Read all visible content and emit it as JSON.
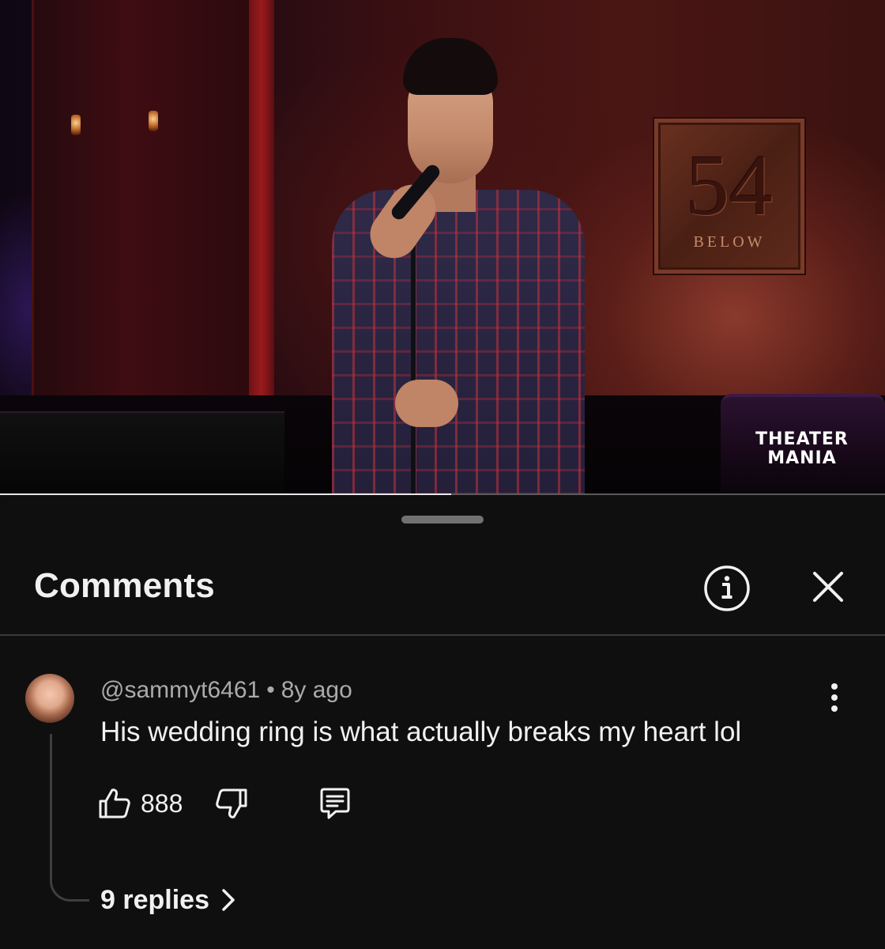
{
  "video": {
    "plaque_number": "54",
    "plaque_text": "BELOW",
    "watermark": "THEATER\nMANIA",
    "progress": 0.51
  },
  "comments_sheet": {
    "title": "Comments",
    "icons": {
      "info": "info-icon",
      "close": "close-icon"
    }
  },
  "comment": {
    "author": "@sammyt6461",
    "separator": "•",
    "time_ago": "8y ago",
    "text": "His wedding ring is what actually breaks my heart lol",
    "like_count": "888",
    "replies_label": "9 replies",
    "icons": {
      "like": "thumbs-up-icon",
      "dislike": "thumbs-down-icon",
      "reply": "reply-icon",
      "more": "more-vert-icon",
      "chevron": "chevron-right-icon"
    }
  },
  "colors": {
    "background": "#0f0f0f",
    "text_primary": "#f1f1f1",
    "text_secondary": "#aaaaaa",
    "divider": "#3a3a3a"
  }
}
